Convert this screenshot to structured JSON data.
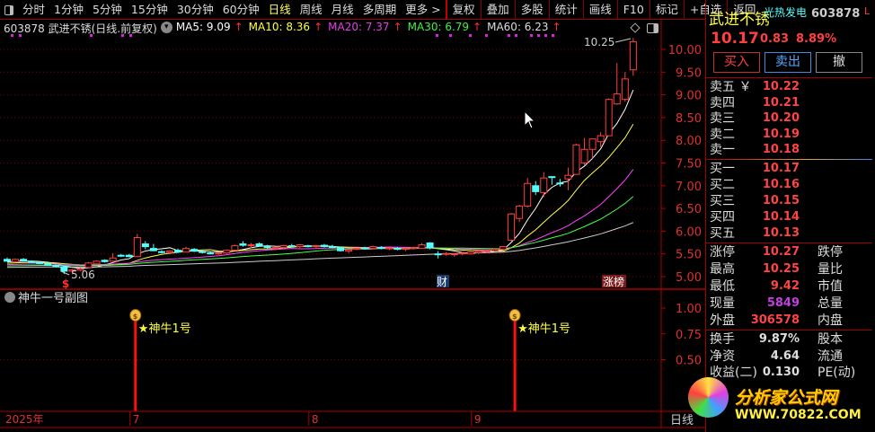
{
  "toolbar": {
    "items": [
      "分时",
      "1分钟",
      "5分钟",
      "15分钟",
      "30分钟",
      "60分钟",
      "日线",
      "周线",
      "月线",
      "多周期",
      "更多 >"
    ],
    "right": [
      "复权",
      "叠加",
      "多股",
      "统计",
      "画线",
      "F10",
      "标记",
      "+自选",
      "返回"
    ],
    "active": "日线"
  },
  "info": {
    "title": "603878 武进不锈(日线.前复权)",
    "ma5": "MA5: 9.09",
    "ma10": "MA10: 8.36",
    "ma20": "MA20: 7.37",
    "ma30": "MA30: 6.79",
    "ma60": "MA60: 6.23",
    "arrow": "↑"
  },
  "colors": {
    "ma5": "#ffffff",
    "ma10": "#ffff44",
    "ma20": "#ff44ff",
    "ma30": "#44ff44",
    "ma60": "#cccccc",
    "up": "#ff4040",
    "down": "#54ffff",
    "axis": "#e03030"
  },
  "chart_data": {
    "type": "candlestick",
    "price_axis": [
      "10.00",
      "9.50",
      "9.00",
      "8.50",
      "8.00",
      "7.50",
      "7.00",
      "6.50",
      "6.00",
      "5.50",
      "5.00"
    ],
    "price_range": [
      4.85,
      10.3
    ],
    "high_label": "10.25",
    "low_label": "5.06",
    "ohlc": [
      [
        5.38,
        5.42,
        5.33,
        5.34
      ],
      [
        5.33,
        5.4,
        5.31,
        5.38
      ],
      [
        5.38,
        5.41,
        5.33,
        5.35
      ],
      [
        5.34,
        5.36,
        5.3,
        5.31
      ],
      [
        5.31,
        5.34,
        5.27,
        5.29
      ],
      [
        5.29,
        5.31,
        5.24,
        5.25
      ],
      [
        5.25,
        5.27,
        5.2,
        5.22
      ],
      [
        5.22,
        5.24,
        5.06,
        5.12
      ],
      [
        5.12,
        5.17,
        5.08,
        5.15
      ],
      [
        5.14,
        5.2,
        5.12,
        5.17
      ],
      [
        5.2,
        5.32,
        5.18,
        5.3
      ],
      [
        5.28,
        5.36,
        5.26,
        5.34
      ],
      [
        5.36,
        5.38,
        5.31,
        5.33
      ],
      [
        5.34,
        5.52,
        5.33,
        5.41
      ],
      [
        5.47,
        5.5,
        5.43,
        5.45
      ],
      [
        5.47,
        5.5,
        5.43,
        5.44
      ],
      [
        5.44,
        5.94,
        5.43,
        5.86
      ],
      [
        5.72,
        5.78,
        5.6,
        5.66
      ],
      [
        5.62,
        5.72,
        5.56,
        5.57
      ],
      [
        5.55,
        5.58,
        5.51,
        5.53
      ],
      [
        5.53,
        5.58,
        5.49,
        5.56
      ],
      [
        5.58,
        5.62,
        5.52,
        5.54
      ],
      [
        5.54,
        5.66,
        5.53,
        5.62
      ],
      [
        5.6,
        5.63,
        5.54,
        5.56
      ],
      [
        5.55,
        5.58,
        5.51,
        5.53
      ],
      [
        5.52,
        5.55,
        5.49,
        5.51
      ],
      [
        5.51,
        5.54,
        5.48,
        5.52
      ],
      [
        5.52,
        5.6,
        5.5,
        5.58
      ],
      [
        5.58,
        5.7,
        5.57,
        5.68
      ],
      [
        5.72,
        5.78,
        5.66,
        5.69
      ],
      [
        5.68,
        5.74,
        5.62,
        5.7
      ],
      [
        5.72,
        5.75,
        5.66,
        5.68
      ],
      [
        5.66,
        5.7,
        5.6,
        5.64
      ],
      [
        5.62,
        5.66,
        5.58,
        5.64
      ],
      [
        5.64,
        5.7,
        5.6,
        5.68
      ],
      [
        5.68,
        5.72,
        5.65,
        5.66
      ],
      [
        5.66,
        5.72,
        5.63,
        5.7
      ],
      [
        5.68,
        5.7,
        5.64,
        5.66
      ],
      [
        5.67,
        5.7,
        5.63,
        5.68
      ],
      [
        5.69,
        5.72,
        5.64,
        5.66
      ],
      [
        5.66,
        5.7,
        5.62,
        5.64
      ],
      [
        5.64,
        5.66,
        5.55,
        5.57
      ],
      [
        5.56,
        5.6,
        5.52,
        5.59
      ],
      [
        5.6,
        5.64,
        5.58,
        5.62
      ],
      [
        5.63,
        5.66,
        5.6,
        5.62
      ],
      [
        5.62,
        5.68,
        5.6,
        5.66
      ],
      [
        5.64,
        5.67,
        5.6,
        5.62
      ],
      [
        5.62,
        5.64,
        5.58,
        5.63
      ],
      [
        5.62,
        5.65,
        5.58,
        5.6
      ],
      [
        5.6,
        5.64,
        5.56,
        5.62
      ],
      [
        5.62,
        5.66,
        5.6,
        5.64
      ],
      [
        5.62,
        5.74,
        5.61,
        5.7
      ],
      [
        5.74,
        5.76,
        5.6,
        5.63
      ],
      [
        5.5,
        5.56,
        5.4,
        5.49
      ],
      [
        5.5,
        5.54,
        5.46,
        5.51
      ],
      [
        5.48,
        5.52,
        5.44,
        5.5
      ],
      [
        5.5,
        5.54,
        5.47,
        5.52
      ],
      [
        5.5,
        5.56,
        5.48,
        5.54
      ],
      [
        5.53,
        5.58,
        5.5,
        5.56
      ],
      [
        5.55,
        5.58,
        5.52,
        5.57
      ],
      [
        5.57,
        5.62,
        5.54,
        5.6
      ],
      [
        5.6,
        5.68,
        5.58,
        5.66
      ],
      [
        5.8,
        6.4,
        5.78,
        6.38
      ],
      [
        6.28,
        6.58,
        6.2,
        6.55
      ],
      [
        6.55,
        7.17,
        6.52,
        7.05
      ],
      [
        7.0,
        7.1,
        6.8,
        6.87
      ],
      [
        6.85,
        7.3,
        6.75,
        7.17
      ],
      [
        7.2,
        7.21,
        7.02,
        7.18
      ],
      [
        7.06,
        7.15,
        6.98,
        7.05
      ],
      [
        7.15,
        7.4,
        6.9,
        7.23
      ],
      [
        7.25,
        7.93,
        7.25,
        7.9
      ],
      [
        7.5,
        8.05,
        7.45,
        7.8
      ],
      [
        7.8,
        8.03,
        7.6,
        8.03
      ],
      [
        7.97,
        8.18,
        7.85,
        8.1
      ],
      [
        8.1,
        8.92,
        8.1,
        8.9
      ],
      [
        8.8,
        9.7,
        8.78,
        9.02
      ],
      [
        8.9,
        9.5,
        8.85,
        9.35
      ],
      [
        9.55,
        10.25,
        9.42,
        10.17
      ]
    ],
    "ma_periods": [
      5,
      10,
      20,
      30,
      60
    ],
    "marks": {
      "cai": "财",
      "zhangbang": "涨榜",
      "dollar": "$"
    },
    "sub": {
      "title": "神牛一号副图",
      "axis": [
        "1.00",
        "0.75",
        "0.50"
      ],
      "signals": [
        {
          "index": 16,
          "label": "★神牛1号"
        },
        {
          "index": 62,
          "label": "★神牛1号"
        }
      ]
    },
    "time_axis": [
      {
        "label": "2025年",
        "index": 0
      },
      {
        "label": "7",
        "index": 15
      },
      {
        "label": "8",
        "index": 37
      },
      {
        "label": "9",
        "index": 57
      }
    ],
    "period_label": "日线"
  },
  "quote": {
    "name": "武进不锈",
    "sector": "光热发电",
    "code": "603878",
    "flag": "L",
    "price": "10.17",
    "change": "0.83",
    "pct": "8.89%",
    "buy": "买入",
    "sell": "卖出",
    "cancel": "撤"
  },
  "book": {
    "asks": [
      {
        "l": "卖五 ￥",
        "v": "10.22"
      },
      {
        "l": "卖四",
        "v": "10.21"
      },
      {
        "l": "卖三",
        "v": "10.20"
      },
      {
        "l": "卖二",
        "v": "10.19"
      },
      {
        "l": "卖一",
        "v": "10.18"
      }
    ],
    "bids": [
      {
        "l": "买一",
        "v": "10.17"
      },
      {
        "l": "买二",
        "v": "10.16"
      },
      {
        "l": "买三",
        "v": "10.15"
      },
      {
        "l": "买四",
        "v": "10.14"
      },
      {
        "l": "买五",
        "v": "10.13"
      }
    ]
  },
  "stats": [
    {
      "l": "涨停",
      "v": "10.27",
      "r": "跌停"
    },
    {
      "l": "最高",
      "v": "10.25",
      "r": "量比"
    },
    {
      "l": "最低",
      "v": "9.42",
      "r": "市值"
    },
    {
      "l": "现量",
      "v": "5849",
      "r": "总量"
    },
    {
      "l": "外盘",
      "v": "306578",
      "r": "内盘"
    }
  ],
  "fin": [
    {
      "l": "换手",
      "v": "9.87%",
      "r": "股本"
    },
    {
      "l": "净资",
      "v": "4.64",
      "r": "流通"
    },
    {
      "l": "收益(二)",
      "v": "0.130",
      "r": "PE(动)"
    }
  ],
  "watermark": {
    "title": "分析家公式网",
    "url": "WWW.70822.COM"
  }
}
